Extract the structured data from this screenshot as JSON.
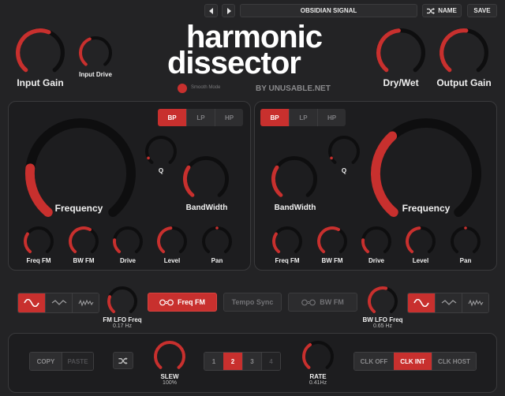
{
  "header": {
    "prev_icon": "prev-arrow-icon",
    "next_icon": "next-arrow-icon",
    "preset_name": "OBSIDIAN SIGNAL",
    "name_label": "NAME",
    "save_label": "SAVE"
  },
  "brand": {
    "line1": "harmonic",
    "line2": "dissector",
    "byline": "BY UNUSABLE.NET",
    "smooth_mode": "Smooth Mode"
  },
  "top_knobs": {
    "input_gain": "Input Gain",
    "input_drive": "Input Drive",
    "dry_wet": "Dry/Wet",
    "output_gain": "Output Gain"
  },
  "filter_left": {
    "modes": [
      "BP",
      "LP",
      "HP"
    ],
    "active_mode": "BP",
    "frequency": "Frequency",
    "q": "Q",
    "bandwidth": "BandWidth",
    "small": [
      "Freq FM",
      "BW FM",
      "Drive",
      "Level",
      "Pan"
    ]
  },
  "filter_right": {
    "modes": [
      "BP",
      "LP",
      "HP"
    ],
    "active_mode": "BP",
    "frequency": "Frequency",
    "q": "Q",
    "bandwidth": "BandWidth",
    "small": [
      "Freq FM",
      "BW FM",
      "Drive",
      "Level",
      "Pan"
    ]
  },
  "lfo": {
    "fm_label": "FM LFO Freq",
    "fm_value": "0.17 Hz",
    "bw_label": "BW LFO Freq",
    "bw_value": "0.65 Hz",
    "freq_fm_btn": "Freq FM",
    "tempo_sync_btn": "Tempo Sync",
    "bw_fm_btn": "BW FM"
  },
  "bottom": {
    "copy": "COPY",
    "paste": "PASTE",
    "slew_label": "SLEW",
    "slew_value": "100%",
    "pages": [
      "1",
      "2",
      "3",
      "4"
    ],
    "active_page": "2",
    "rate_label": "RATE",
    "rate_value": "0.41Hz",
    "clk_off": "CLK OFF",
    "clk_int": "CLK INT",
    "clk_host": "CLK HOST"
  },
  "colors": {
    "accent": "#c8302e",
    "background": "#232325",
    "panel": "#1d1d1f",
    "knob_track": "#0e0e0f"
  }
}
